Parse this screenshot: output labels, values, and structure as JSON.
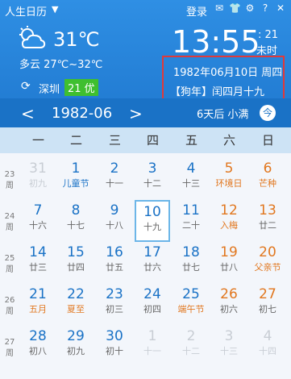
{
  "app": {
    "title": "人生日历",
    "login": "登录"
  },
  "weather": {
    "temp": "31℃",
    "desc": "多云 27℃~32℃",
    "city": "深圳",
    "aqi": "21 优"
  },
  "clock": {
    "time": "13:55",
    "seconds": ": 21",
    "note": "未时"
  },
  "date": {
    "solar": "1982年06月10日 周四",
    "lunar": "【狗年】闰四月十九"
  },
  "nav": {
    "month": "1982-06",
    "prev": "<",
    "next": ">",
    "term": "6天后 小满",
    "today": "今"
  },
  "weekdays": [
    "一",
    "二",
    "三",
    "四",
    "五",
    "六",
    "日"
  ],
  "weeks": [
    {
      "num": "23",
      "label": "周"
    },
    {
      "num": "24",
      "label": "周"
    },
    {
      "num": "25",
      "label": "周"
    },
    {
      "num": "26",
      "label": "周"
    },
    {
      "num": "27",
      "label": "周"
    }
  ],
  "days": [
    {
      "d": "31",
      "l": "初九"
    },
    {
      "d": "1",
      "l": "儿童节"
    },
    {
      "d": "2",
      "l": "十一"
    },
    {
      "d": "3",
      "l": "十二"
    },
    {
      "d": "4",
      "l": "十三"
    },
    {
      "d": "5",
      "l": "环境日"
    },
    {
      "d": "6",
      "l": "芒种"
    },
    {
      "d": "7",
      "l": "十六"
    },
    {
      "d": "8",
      "l": "十七"
    },
    {
      "d": "9",
      "l": "十八"
    },
    {
      "d": "10",
      "l": "十九"
    },
    {
      "d": "11",
      "l": "二十"
    },
    {
      "d": "12",
      "l": "入梅"
    },
    {
      "d": "13",
      "l": "廿二"
    },
    {
      "d": "14",
      "l": "廿三"
    },
    {
      "d": "15",
      "l": "廿四"
    },
    {
      "d": "16",
      "l": "廿五"
    },
    {
      "d": "17",
      "l": "廿六"
    },
    {
      "d": "18",
      "l": "廿七"
    },
    {
      "d": "19",
      "l": "廿八"
    },
    {
      "d": "20",
      "l": "父亲节"
    },
    {
      "d": "21",
      "l": "五月"
    },
    {
      "d": "22",
      "l": "夏至"
    },
    {
      "d": "23",
      "l": "初三"
    },
    {
      "d": "24",
      "l": "初四"
    },
    {
      "d": "25",
      "l": "端午节"
    },
    {
      "d": "26",
      "l": "初六"
    },
    {
      "d": "27",
      "l": "初七"
    },
    {
      "d": "28",
      "l": "初八"
    },
    {
      "d": "29",
      "l": "初九"
    },
    {
      "d": "30",
      "l": "初十"
    },
    {
      "d": "1",
      "l": "十一"
    },
    {
      "d": "2",
      "l": "十二"
    },
    {
      "d": "3",
      "l": "十三"
    },
    {
      "d": "4",
      "l": "十四"
    }
  ],
  "colors": {
    "accent": "#1f78cf",
    "highlight": "#e03a3a",
    "aqi": "#3fbf2f",
    "weekend": "#e1771f"
  }
}
